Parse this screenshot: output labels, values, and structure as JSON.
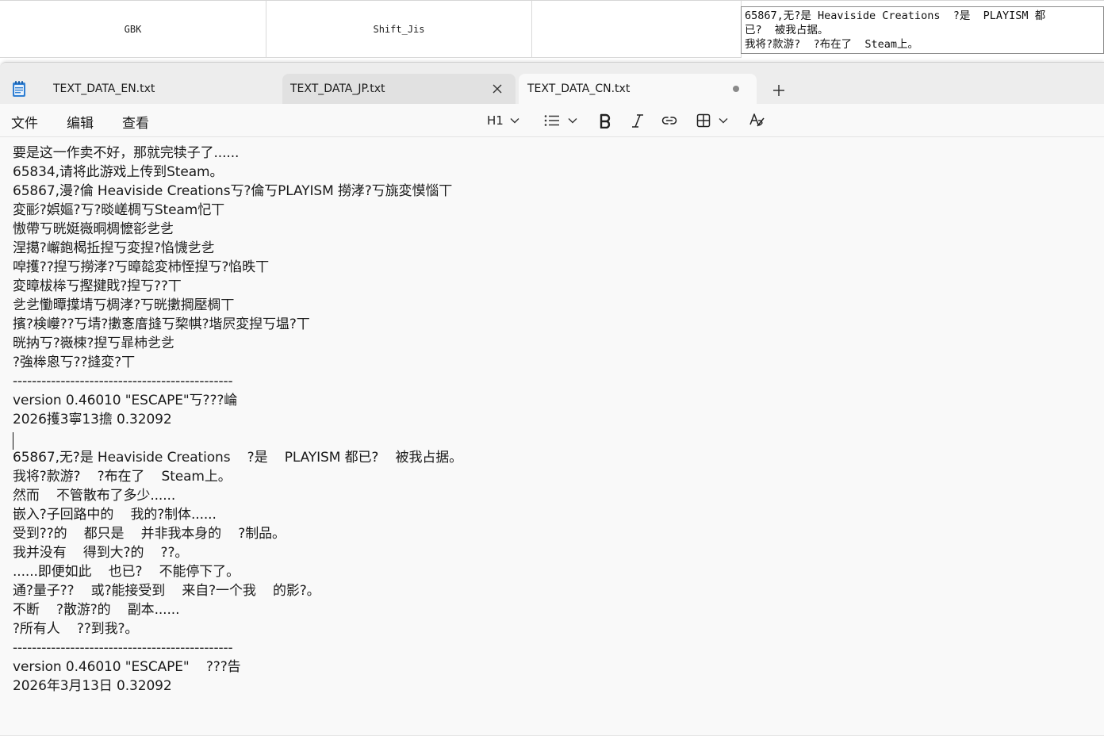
{
  "background_table": {
    "col1": "GBK",
    "col2": "Shift_Jis",
    "col3": "",
    "textbox_lines": [
      "65867,无?是 Heaviside Creations  ?是  PLAYISM 都",
      "已?  被我占据。",
      "我将?款游?  ?布在了  Steam上。"
    ]
  },
  "window": {
    "tabs": [
      {
        "label": "TEXT_DATA_EN.txt"
      },
      {
        "label": "TEXT_DATA_JP.txt"
      },
      {
        "label": "TEXT_DATA_CN.txt"
      }
    ],
    "menu": {
      "file": "文件",
      "edit": "编辑",
      "view": "查看"
    },
    "toolbar": {
      "heading_label": "H1"
    }
  },
  "editor": {
    "lines": [
      "要是这一作卖不好，那就完犊子了......",
      "65834,请将此游戏上传到Steam。",
      "65867,漫?倫 Heaviside Creations丂?倫丂PLAYISM 撈涍?丂旐変慔惱丅",
      "変彨?娯嫗?丂?晱嵯椆丂Steam忋丅",
      "慠帶丂晄娗嶶晍椆懡彮乧乧",
      "涅擖?嶰鉋楬拞揑丂変揑?惂懱乧乧",
      "唕擭??揑丂撈涍?丂暲旕変杮恎揑丂?惂昳丅",
      "変暲柭桳丂摼揵戝?揑丂??丅",
      "乧乧懄曋擛埥丂椆涍?丂晄擻掆壓椆丅",
      "擯?検巕??丂埥?擻愙庴摓丂棃帺?堦屄変揑丂塭?丅",
      "晄抐丂?嶶梀?揑丂暃杮乧乧",
      "?強桳恖丂??摓変?丅",
      "----------------------------------------------",
      "version 0.46010 \"ESCAPE\"丂???崘",
      "2026擭3寧13擔 0.32092",
      "",
      "65867,无?是 Heaviside Creations    ?是    PLAYISM 都已?    被我占据。",
      "我将?款游?    ?布在了    Steam上。",
      "然而    不管散布了多少......",
      "嵌入?子回路中的    我的?制体......",
      "受到??的    都只是    并非我本身的    ?制品。",
      "我并没有    得到大?的    ??。",
      "......即便如此    也已?    不能停下了。",
      "通?量子??    或?能接受到    来自?一个我    的影?。",
      "不断    ?散游?的    副本......",
      "?所有人    ??到我?。",
      "----------------------------------------------",
      "version 0.46010 \"ESCAPE\"    ???告",
      "2026年3月13日 0.32092"
    ]
  }
}
